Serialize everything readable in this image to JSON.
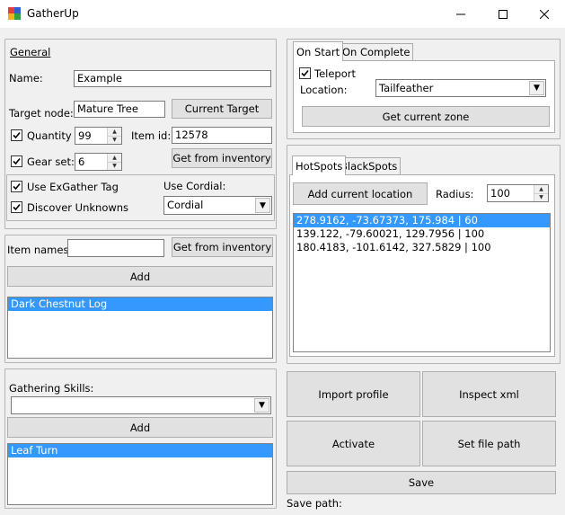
{
  "window": {
    "title": "GatherUp"
  },
  "general": {
    "legend": "General",
    "name_label": "Name:",
    "name_value": "Example",
    "target_node_label": "Target node:",
    "target_node_value": "Mature Tree",
    "current_target_button": "Current Target",
    "quantity_label": "Quantity",
    "quantity_value": "99",
    "quantity_checked": true,
    "item_id_label": "Item id:",
    "item_id_value": "12578",
    "gear_set_label": "Gear set:",
    "gear_set_value": "6",
    "gear_set_checked": true,
    "get_from_inventory_button": "Get from inventory",
    "use_exgather_label": "Use ExGather Tag",
    "use_exgather_checked": true,
    "discover_unknowns_label": "Discover Unknowns",
    "discover_unknowns_checked": true,
    "use_cordial_label": "Use Cordial:",
    "use_cordial_value": "Cordial"
  },
  "items": {
    "item_names_label": "Item names:",
    "item_names_value": "",
    "get_from_inventory_button": "Get from inventory",
    "add_button": "Add",
    "list": [
      "Dark Chestnut Log"
    ]
  },
  "skills": {
    "label": "Gathering Skills:",
    "combo_value": "",
    "add_button": "Add",
    "list": [
      "Leaf Turn"
    ]
  },
  "start_tabs": {
    "tabs": [
      "On Start",
      "On Complete"
    ],
    "teleport_label": "Teleport",
    "teleport_checked": true,
    "location_label": "Location:",
    "location_value": "Tailfeather",
    "get_zone_button": "Get current zone"
  },
  "spots_tabs": {
    "tabs": [
      "HotSpots",
      "BlackSpots"
    ],
    "add_location_button": "Add current location",
    "radius_label": "Radius:",
    "radius_value": "100",
    "list": [
      "278.9162, -73.67373, 175.984 | 60",
      "139.122, -79.60021, 129.7956 | 100",
      "180.4183, -101.6142, 327.5829 | 100"
    ]
  },
  "actions": {
    "import_profile": "Import profile",
    "inspect_xml": "Inspect xml",
    "activate": "Activate",
    "set_file_path": "Set file path",
    "save": "Save",
    "save_path_label": "Save path:"
  }
}
